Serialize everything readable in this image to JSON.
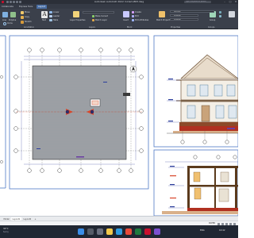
{
  "window": {
    "title": "Autodesk AutoCAD 2022   miriam-BIM.dwg",
    "search_placeholder": "Type a keyword or phrase",
    "minimize": "–",
    "maximize": "□",
    "close": "✕"
  },
  "tabs": [
    {
      "label": "Collaborate"
    },
    {
      "label": "Express Tools"
    },
    {
      "label": "Layout"
    }
  ],
  "ribbon": {
    "draw": {
      "line": "Line",
      "polyline": "Polyline",
      "circle": "Circle",
      "arc": "Arc"
    },
    "modify": {
      "move": "Move",
      "copy": "Copy",
      "stretch": "Stretch"
    },
    "annotation": {
      "text": "Text",
      "linear": "Linear",
      "leader": "Leader",
      "table": "Table"
    },
    "layers": {
      "layer_properties": "Layer Properties",
      "make_current": "Make Current",
      "match_layer": "Match Layer"
    },
    "block": {
      "insert": "Insert",
      "create": "Create",
      "edit": "Edit",
      "edit_attributes": "Edit Attributes"
    },
    "properties": {
      "match_properties": "Match Properties",
      "bylayer_1": "ByLayer",
      "bylayer_2": "ByLayer",
      "bylayer_3": "ByLayer"
    },
    "groups": {
      "group": "Group"
    },
    "layer_current": "Surface",
    "panels": {
      "annotation": "Annotation",
      "layers": "Layers",
      "block": "Block",
      "properties": "Properties",
      "groups": "Groups"
    }
  },
  "layout_tabs": [
    {
      "label": "Model"
    },
    {
      "label": "Layout1"
    },
    {
      "label": "Layout2"
    },
    {
      "label": "+"
    }
  ],
  "status": {
    "paper": "PAPER"
  },
  "taskbar": {
    "weather_temp": "32°C",
    "weather_desc": "Sunny",
    "lang": "ENG",
    "time": "10:42"
  },
  "colors": {
    "accent": "#4a6fa5",
    "ribbon_bg": "#3b404b",
    "viewport_border": "#4e79c6",
    "roof_hatch": "#9ea2a8",
    "section_cut": "#d8462a",
    "dimension": "#2c3e9c",
    "wall": "#5a3a1c"
  }
}
